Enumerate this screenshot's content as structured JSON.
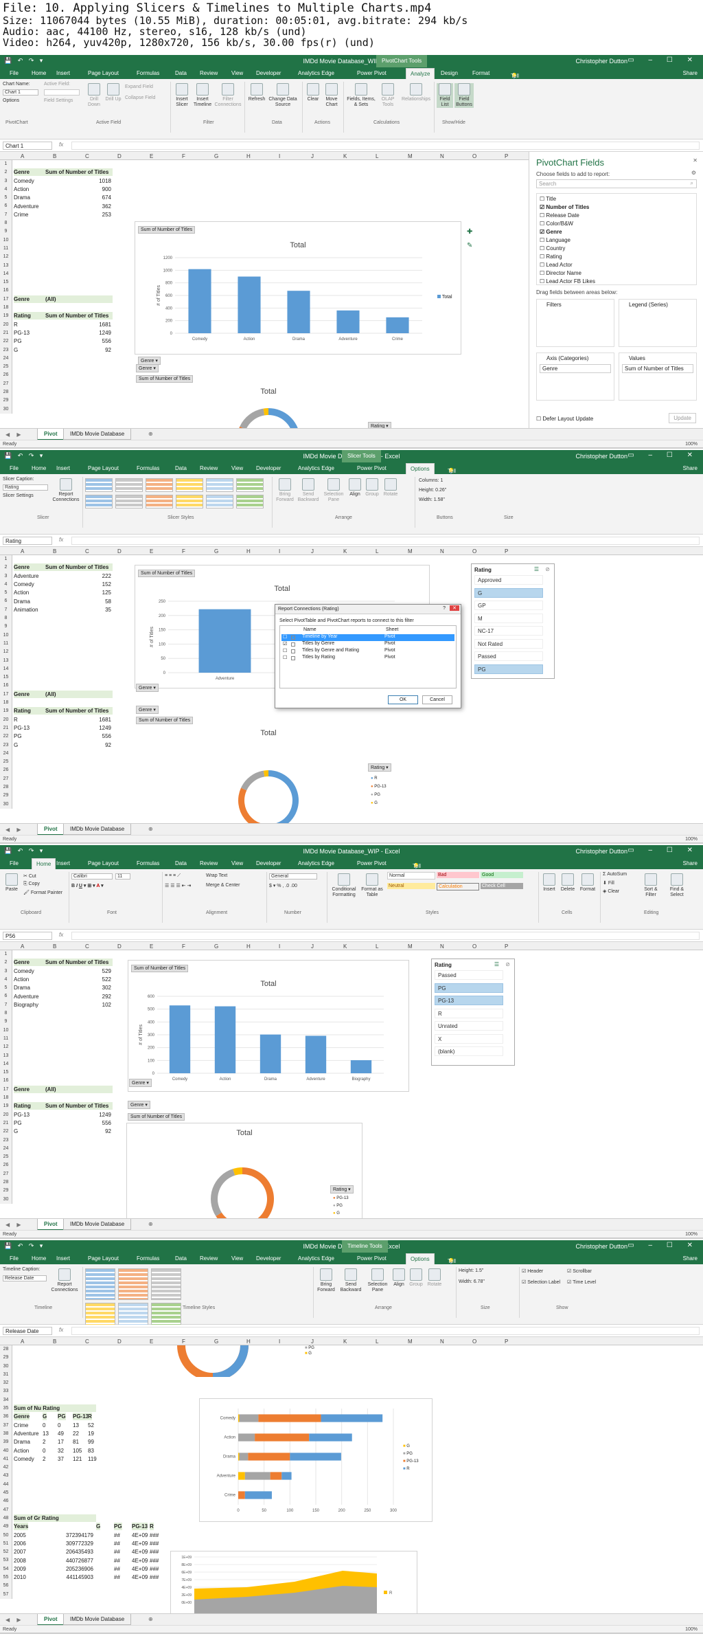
{
  "header": {
    "lines": [
      "File: 10. Applying Slicers & Timelines to Multiple Charts.mp4",
      "Size: 11067044 bytes (10.55 MiB), duration: 00:05:01, avg.bitrate: 294 kb/s",
      "Audio: aac, 44100 Hz, stereo, s16, 128 kb/s (und)",
      "Video: h264, yuv420p, 1280x720, 156 kb/s, 30.00 fps(r) (und)"
    ]
  },
  "app": {
    "doc_title_wip": "IMDd Movie Database_WIP - Excel",
    "doc_title": "IMDd Movie Database_WIP - Excel",
    "user": "Christopher Dutton",
    "share": "Share",
    "tell_me": "Tell me what you want to do",
    "ready": "Ready",
    "zoom": "100%",
    "file_tab": "File"
  },
  "frames": [
    {
      "ctx_label": "PivotChart Tools",
      "tabs": [
        "Home",
        "Insert",
        "Page Layout",
        "Formulas",
        "Data",
        "Review",
        "View",
        "Developer",
        "Analytics Edge",
        "Power Pivot",
        "Analyze",
        "Design",
        "Format"
      ],
      "active_tab": "Analyze",
      "ribbon": {
        "chart_name_label": "Chart Name:",
        "chart_name": "Chart 1",
        "options": "Options",
        "active_field_label": "Active Field:",
        "field_settings": "Field Settings",
        "drill_down": "Drill Down",
        "drill_up": "Drill Up",
        "expand": "Expand Field",
        "collapse": "Collapse Field",
        "insert_slicer": "Insert Slicer",
        "insert_timeline": "Insert Timeline",
        "filter_conn": "Filter Connections",
        "refresh": "Refresh",
        "change_ds": "Change Data Source",
        "clear": "Clear",
        "move_chart": "Move Chart",
        "fields_items": "Fields, Items, & Sets",
        "olap": "OLAP Tools",
        "relationships": "Relationships",
        "field_list": "Field List",
        "field_buttons": "Field Buttons",
        "groups": [
          "PivotChart",
          "Active Field",
          "Filter",
          "Data",
          "Actions",
          "Calculations",
          "Show/Hide"
        ]
      },
      "namebox": "Chart 1",
      "cols": [
        "A",
        "B",
        "C",
        "D",
        "E",
        "F",
        "G",
        "H",
        "I",
        "J",
        "K",
        "L",
        "M",
        "N",
        "O",
        "P"
      ],
      "rows": [
        "1",
        "2",
        "3",
        "4",
        "5",
        "6",
        "7",
        "8",
        "9",
        "10",
        "11",
        "12",
        "13",
        "14",
        "15",
        "16",
        "17",
        "18",
        "19",
        "20",
        "21",
        "22",
        "23",
        "24",
        "25",
        "26",
        "27",
        "28",
        "29",
        "30"
      ],
      "pivot1": {
        "h1": "Genre",
        "h2": "Sum of Number of Titles",
        "rows": [
          [
            "Comedy",
            "1018"
          ],
          [
            "Action",
            "900"
          ],
          [
            "Drama",
            "674"
          ],
          [
            "Adventure",
            "362"
          ],
          [
            "Crime",
            "253"
          ]
        ]
      },
      "filter_row": {
        "label": "Genre",
        "value": "(All)"
      },
      "pivot2": {
        "h1": "Rating",
        "h2": "Sum of Number of Titles",
        "rows": [
          [
            "R",
            "1681"
          ],
          [
            "PG-13",
            "1249"
          ],
          [
            "PG",
            "556"
          ],
          [
            "G",
            "92"
          ]
        ]
      },
      "chip_sum": "Sum of Number of Titles",
      "chip_genre": "Genre",
      "chip_rating": "Rating",
      "sheets": [
        "Pivot",
        "IMDb Movie Database"
      ],
      "pane": {
        "title": "PivotChart Fields",
        "sub": "Choose fields to add to report:",
        "search": "Search",
        "fields": [
          "Title",
          "Number of Titles",
          "Release Date",
          "Color/B&W",
          "Genre",
          "Language",
          "Country",
          "Rating",
          "Lead Actor",
          "Director Name",
          "Lead Actor FB Likes"
        ],
        "checked": [
          false,
          true,
          false,
          false,
          true,
          false,
          false,
          false,
          false,
          false,
          false
        ],
        "drag": "Drag fields between areas below:",
        "filters": "Filters",
        "legend": "Legend (Series)",
        "axis": "Axis (Categories)",
        "values": "Values",
        "axis_val": "Genre",
        "values_val": "Sum of Number of Titles",
        "defer": "Defer Layout Update",
        "update": "Update"
      }
    },
    {
      "ctx_label": "Slicer Tools",
      "tabs": [
        "Home",
        "Insert",
        "Page Layout",
        "Formulas",
        "Data",
        "Review",
        "View",
        "Developer",
        "Analytics Edge",
        "Power Pivot",
        "Options"
      ],
      "active_tab": "Options",
      "ribbon": {
        "caption_label": "Slicer Caption:",
        "caption": "Rating",
        "report_conn": "Report Connections",
        "slicer_settings": "Slicer Settings",
        "columns": "Columns: 1",
        "height": "Height: 0.26\"",
        "width": "Width: 1.58\"",
        "bring": "Bring Forward",
        "send": "Send Backward",
        "selpane": "Selection Pane",
        "align": "Align",
        "group": "Group",
        "rotate": "Rotate",
        "groups": [
          "Slicer",
          "Slicer Styles",
          "Arrange",
          "Buttons",
          "Size"
        ]
      },
      "namebox": "Rating",
      "pivot1": {
        "h1": "Genre",
        "h2": "Sum of Number of Titles",
        "rows": [
          [
            "Adventure",
            "222"
          ],
          [
            "Comedy",
            "152"
          ],
          [
            "Action",
            "125"
          ],
          [
            "Drama",
            "58"
          ],
          [
            "Animation",
            "35"
          ]
        ]
      },
      "filter_row": {
        "label": "Genre",
        "value": "(All)"
      },
      "pivot2": {
        "h1": "Rating",
        "h2": "Sum of Number of Titles",
        "rows": [
          [
            "R",
            "1681"
          ],
          [
            "PG-13",
            "1249"
          ],
          [
            "PG",
            "556"
          ],
          [
            "G",
            "92"
          ]
        ]
      },
      "slicer": {
        "title": "Rating",
        "items": [
          "Approved",
          "G",
          "GP",
          "M",
          "NC-17",
          "Not Rated",
          "Passed",
          "PG"
        ],
        "selected": [
          false,
          true,
          false,
          false,
          false,
          false,
          false,
          true
        ]
      },
      "dialog": {
        "title": "Report Connections (Rating)",
        "instruction": "Select PivotTable and PivotChart reports to connect to this filter",
        "col_name": "Name",
        "col_sheet": "Sheet",
        "rows": [
          [
            "Timeline by Year",
            "Pivot"
          ],
          [
            "Titles by Genre",
            "Pivot"
          ],
          [
            "Titles by Genre and Rating",
            "Pivot"
          ],
          [
            "Titles by Rating",
            "Pivot"
          ]
        ],
        "checked": [
          false,
          true,
          false,
          false
        ],
        "ok": "OK",
        "cancel": "Cancel"
      }
    },
    {
      "tabs": [
        "Home",
        "Insert",
        "Page Layout",
        "Formulas",
        "Data",
        "Review",
        "View",
        "Developer",
        "Analytics Edge",
        "Power Pivot"
      ],
      "active_tab": "Home",
      "ribbon": {
        "paste": "Paste",
        "cut": "Cut",
        "copy": "Copy",
        "painter": "Format Painter",
        "font": "Calibri",
        "size": "11",
        "wrap": "Wrap Text",
        "merge": "Merge & Center",
        "numfmt": "General",
        "cond": "Conditional Formatting",
        "fmt_table": "Format as Table",
        "styles": [
          "Normal",
          "Bad",
          "Good",
          "Neutral",
          "Calculation",
          "Check Cell"
        ],
        "insert": "Insert",
        "delete": "Delete",
        "format": "Format",
        "autosum": "AutoSum",
        "fill": "Fill",
        "clear": "Clear",
        "sort": "Sort & Filter",
        "find": "Find & Select",
        "groups": [
          "Clipboard",
          "Font",
          "Alignment",
          "Number",
          "Styles",
          "Cells",
          "Editing"
        ]
      },
      "namebox": "P56",
      "pivot1": {
        "h1": "Genre",
        "h2": "Sum of Number of Titles",
        "rows": [
          [
            "Comedy",
            "529"
          ],
          [
            "Action",
            "522"
          ],
          [
            "Drama",
            "302"
          ],
          [
            "Adventure",
            "292"
          ],
          [
            "Biography",
            "102"
          ]
        ]
      },
      "filter_row": {
        "label": "Genre",
        "value": "(All)"
      },
      "pivot2": {
        "h1": "Rating",
        "h2": "Sum of Number of Titles",
        "rows": [
          [
            "PG-13",
            "1249"
          ],
          [
            "PG",
            "556"
          ],
          [
            "G",
            "92"
          ]
        ]
      },
      "slicer": {
        "title": "Rating",
        "items": [
          "Passed",
          "PG",
          "PG-13",
          "R",
          "Unrated",
          "X",
          "(blank)"
        ],
        "selected": [
          false,
          true,
          true,
          false,
          false,
          false,
          false
        ]
      }
    },
    {
      "ctx_label": "Timeline Tools",
      "tabs": [
        "Home",
        "Insert",
        "Page Layout",
        "Formulas",
        "Data",
        "Review",
        "View",
        "Developer",
        "Analytics Edge",
        "Power Pivot",
        "Options"
      ],
      "active_tab": "Options",
      "ribbon": {
        "caption_label": "Timeline Caption:",
        "caption": "Release Date",
        "report_conn": "Report Connections",
        "height": "Height: 1.5\"",
        "width": "Width: 6.78\"",
        "header": "Header",
        "selection_label": "Selection Label",
        "scrollbar": "Scrollbar",
        "time_level": "Time Level",
        "groups": [
          "Timeline",
          "Timeline Styles",
          "Arrange",
          "Size",
          "Show"
        ]
      },
      "namebox": "Release Date",
      "rows": [
        "28",
        "29",
        "30",
        "31",
        "32",
        "33",
        "34",
        "35",
        "36",
        "37",
        "38",
        "39",
        "40",
        "41",
        "42",
        "43",
        "44",
        "45",
        "46",
        "47",
        "48",
        "49",
        "50",
        "51",
        "52",
        "53",
        "54",
        "55",
        "56",
        "57"
      ],
      "pivot3": {
        "title": "Sum of Nu Rating",
        "h1": "Genre",
        "cols": [
          "G",
          "PG",
          "PG-13",
          "R"
        ],
        "rows": [
          [
            "Crime",
            "0",
            "0",
            "13",
            "52"
          ],
          [
            "Adventure",
            "13",
            "49",
            "22",
            "19"
          ],
          [
            "Drama",
            "2",
            "17",
            "81",
            "99"
          ],
          [
            "Action",
            "0",
            "32",
            "105",
            "83"
          ],
          [
            "Comedy",
            "2",
            "37",
            "121",
            "119"
          ]
        ]
      },
      "pivot4": {
        "title": "Sum of Gr Rating",
        "h1": "Years",
        "cols": [
          "G",
          "PG",
          "PG-13",
          "R"
        ],
        "rows": [
          [
            "2005",
            "372394179",
            "##",
            "4E+09",
            "###"
          ],
          [
            "2006",
            "309772329",
            "##",
            "4E+09",
            "###"
          ],
          [
            "2007",
            "206435493",
            "##",
            "4E+09",
            "###"
          ],
          [
            "2008",
            "440726877",
            "##",
            "4E+09",
            "###"
          ],
          [
            "2009",
            "205236906",
            "##",
            "4E+09",
            "###"
          ],
          [
            "2010",
            "441145903",
            "##",
            "4E+09",
            "###"
          ]
        ]
      }
    }
  ],
  "chart_data": [
    {
      "type": "bar",
      "title": "Total",
      "ylabel": "# of Titles",
      "categories": [
        "Comedy",
        "Action",
        "Drama",
        "Adventure",
        "Crime"
      ],
      "values": [
        1018,
        900,
        674,
        362,
        253
      ],
      "ylim": [
        0,
        1200
      ],
      "yticks": [
        0,
        200,
        400,
        600,
        800,
        1000,
        1200
      ],
      "legend": "Total"
    },
    {
      "type": "pie",
      "title": "Total",
      "categories": [
        "R",
        "PG-13",
        "PG",
        "G"
      ],
      "values": [
        1681,
        1249,
        556,
        92
      ],
      "legend_title": "Rating"
    },
    {
      "type": "bar",
      "title": "Total",
      "ylabel": "# of Titles",
      "categories": [
        "Adventure",
        "Comedy"
      ],
      "values": [
        222,
        152
      ],
      "ylim": [
        0,
        250
      ],
      "yticks": [
        0,
        50,
        100,
        150,
        200,
        250
      ]
    },
    {
      "type": "pie",
      "title": "Total",
      "categories": [
        "R",
        "PG-13",
        "PG",
        "G"
      ],
      "values": [
        1681,
        1249,
        556,
        92
      ],
      "legend_title": "Rating"
    },
    {
      "type": "bar",
      "title": "Total",
      "ylabel": "# of Titles",
      "categories": [
        "Comedy",
        "Action",
        "Drama",
        "Adventure",
        "Biography"
      ],
      "values": [
        529,
        522,
        302,
        292,
        102
      ],
      "ylim": [
        0,
        600
      ],
      "yticks": [
        0,
        100,
        200,
        300,
        400,
        500,
        600
      ]
    },
    {
      "type": "pie",
      "title": "Total",
      "categories": [
        "PG-13",
        "PG",
        "G"
      ],
      "values": [
        1249,
        556,
        92
      ],
      "legend_title": "Rating"
    },
    {
      "type": "bar",
      "stacked": true,
      "orientation": "horizontal",
      "categories": [
        "Comedy",
        "Action",
        "Drama",
        "Adventure",
        "Crime"
      ],
      "series": [
        {
          "name": "G",
          "values": [
            2,
            0,
            2,
            13,
            0
          ]
        },
        {
          "name": "PG",
          "values": [
            37,
            32,
            17,
            49,
            0
          ]
        },
        {
          "name": "PG-13",
          "values": [
            121,
            105,
            81,
            22,
            13
          ]
        },
        {
          "name": "R",
          "values": [
            119,
            83,
            99,
            19,
            52
          ]
        }
      ],
      "xlim": [
        0,
        300
      ],
      "xticks": [
        0,
        50,
        100,
        150,
        200,
        250,
        300
      ]
    },
    {
      "type": "area",
      "yticks": [
        "1E+09",
        "8E+09",
        "6E+09",
        "7E+09",
        "4E+09",
        "2E+09",
        "0E+00"
      ],
      "legend": [
        "R"
      ]
    }
  ],
  "colors": {
    "excel_green": "#217346",
    "bar": "#5b9bd5",
    "R": "#5b9bd5",
    "PG-13": "#ed7d31",
    "PG": "#a5a5a5",
    "G": "#ffc000"
  }
}
